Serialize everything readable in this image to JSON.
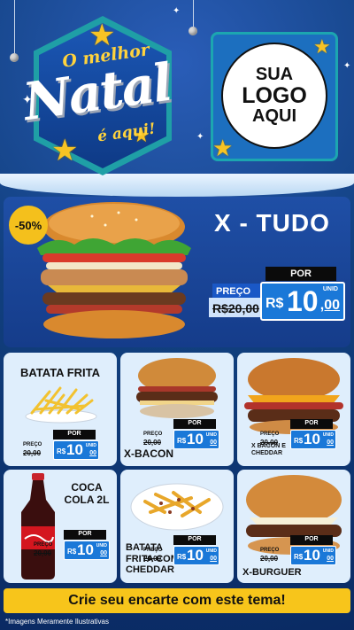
{
  "header": {
    "title_top": "O melhor",
    "title_main": "Natal",
    "title_bottom": "é aqui!"
  },
  "logo": {
    "line1": "SUA",
    "line2": "LOGO",
    "line3": "AQUI"
  },
  "featured": {
    "discount_badge": "-50%",
    "name": "X - TUDO",
    "por_label": "POR",
    "preco_label": "PREÇO",
    "old_price": "R$20,00",
    "currency": "R$",
    "price_int": "10",
    "price_dec": ",00",
    "unit": "UNID"
  },
  "products": [
    {
      "name": "BATATA FRITA",
      "preco_label": "PREÇO",
      "old_price": "20,00",
      "por_label": "POR",
      "currency": "R$",
      "price_int": "10",
      "price_dec": "00",
      "unit": "UNID"
    },
    {
      "name": "X-BACON",
      "preco_label": "PREÇO",
      "old_price": "20,00",
      "por_label": "POR",
      "currency": "R$",
      "price_int": "10",
      "price_dec": "00",
      "unit": "UNID"
    },
    {
      "name": "X BACON E CHEDDAR",
      "preco_label": "PREÇO",
      "old_price": "20,00",
      "por_label": "POR",
      "currency": "R$",
      "price_int": "10",
      "price_dec": "00",
      "unit": "UNID"
    },
    {
      "name": "COCA COLA 2L",
      "preco_label": "PREÇO",
      "old_price": "20,00",
      "por_label": "POR",
      "currency": "R$",
      "price_int": "10",
      "price_dec": "00",
      "unit": "UNID"
    },
    {
      "name": "BATATA FRITA COM CHEDDAR",
      "preco_label": "PREÇO",
      "old_price": "20,00",
      "por_label": "POR",
      "currency": "R$",
      "price_int": "10",
      "price_dec": "00",
      "unit": "UNID"
    },
    {
      "name": "X-BURGUER",
      "preco_label": "PREÇO",
      "old_price": "20,00",
      "por_label": "POR",
      "currency": "R$",
      "price_int": "10",
      "price_dec": "00",
      "unit": "UNID"
    }
  ],
  "cta": "Crie seu encarte com este tema!",
  "disclaimer": "*Imagens Meramente Ilustrativas",
  "colors": {
    "background": "#11407f",
    "accent_yellow": "#f7c51b",
    "price_blue": "#1a78d8",
    "card_bg": "#dfeefc"
  }
}
